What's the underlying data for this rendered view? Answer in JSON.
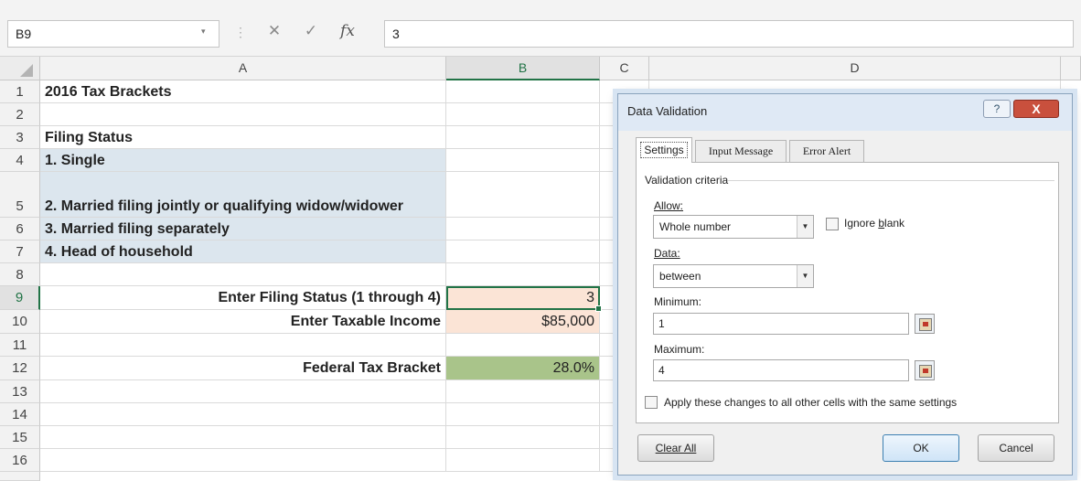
{
  "formula_bar": {
    "name_box": "B9",
    "sep": "⋮",
    "cancel_glyph": "✕",
    "enter_glyph": "✓",
    "fx_glyph": "fx",
    "formula": "3",
    "dropdown_glyph": "▾"
  },
  "columns": [
    "A",
    "B",
    "C",
    "D"
  ],
  "rows": [
    "1",
    "2",
    "3",
    "4",
    "5",
    "6",
    "7",
    "8",
    "9",
    "10",
    "11",
    "12",
    "13",
    "14",
    "15",
    "16"
  ],
  "cells": {
    "a1": "2016 Tax Brackets",
    "a3": "Filing Status",
    "a4": "1. Single",
    "a5": "2. Married filing jointly or qualifying widow/widower",
    "a6": "3. Married filing separately",
    "a7": "4. Head of household",
    "a9": "Enter Filing Status (1 through 4)",
    "b9": "3",
    "a10": "Enter Taxable Income",
    "b10": "$85,000",
    "a12": "Federal Tax Bracket",
    "b12": "28.0%"
  },
  "colors": {
    "blue_fill": "#dce6ee",
    "peach_fill": "#fbe4d6",
    "green_fill": "#a9c48a",
    "selection": "#217346"
  },
  "dialog": {
    "title": "Data Validation",
    "help_glyph": "?",
    "close_glyph": "X",
    "tabs": [
      "Settings",
      "Input Message",
      "Error Alert"
    ],
    "validation_criteria": "Validation criteria",
    "allow_label": "Allow:",
    "allow_value": "Whole number",
    "ignore_blank_pre": "Ignore ",
    "ignore_blank_u": "b",
    "ignore_blank_post": "lank",
    "data_label": "Data:",
    "data_value": "between",
    "minimum_label": "Minimum:",
    "minimum_value": "1",
    "maximum_label": "Maximum:",
    "maximum_value": "4",
    "apply_label": "Apply these changes to all other cells with the same settings",
    "clear_all": "Clear All",
    "ok": "OK",
    "cancel": "Cancel",
    "arrow_glyph": "▼"
  }
}
